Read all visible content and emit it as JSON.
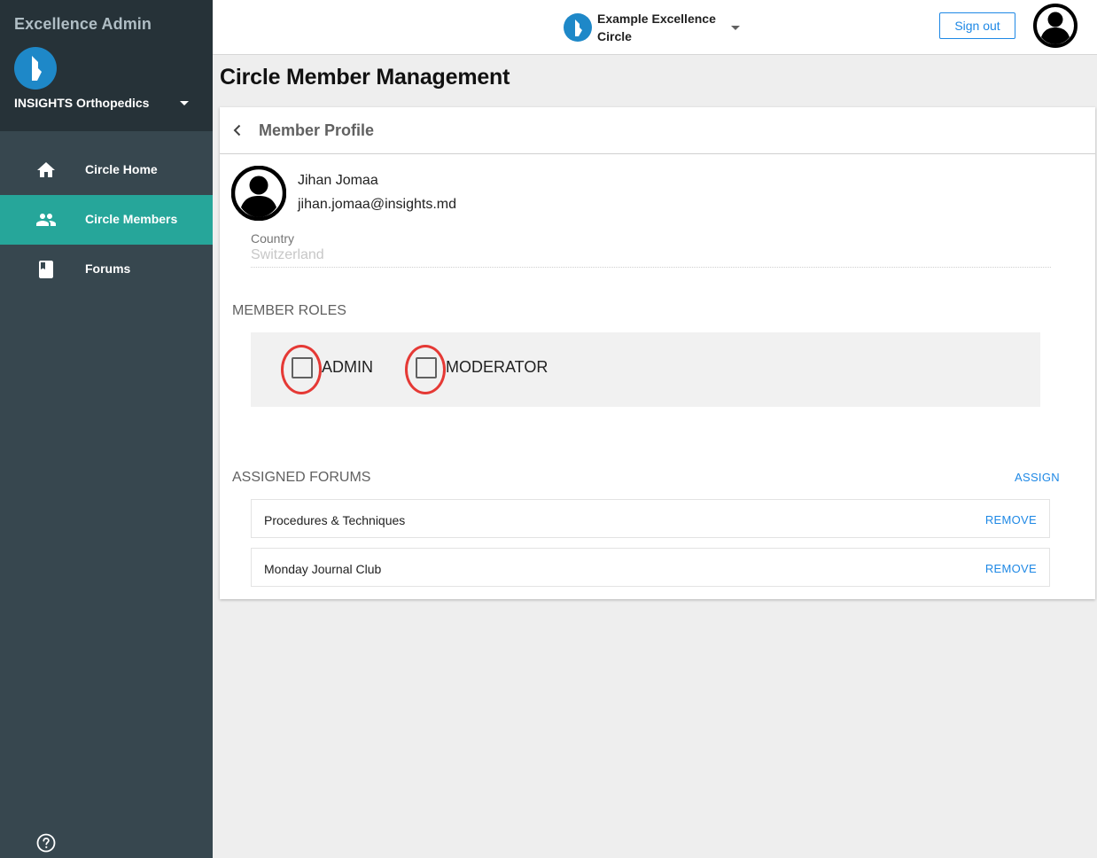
{
  "sidebar": {
    "app_title": "Excellence Admin",
    "org_name": "INSIGHTS Orthopedics",
    "items": [
      {
        "label": "Circle Home",
        "icon": "home-icon",
        "active": false
      },
      {
        "label": "Circle Members",
        "icon": "people-icon",
        "active": true
      },
      {
        "label": "Forums",
        "icon": "book-icon",
        "active": false
      }
    ]
  },
  "topbar": {
    "circle_name": "Example Excellence Circle",
    "signout_label": "Sign out"
  },
  "page": {
    "title": "Circle Member Management"
  },
  "profile": {
    "header_title": "Member Profile",
    "name": "Jihan Jomaa",
    "email": "jihan.jomaa@insights.md",
    "country_label": "Country",
    "country_value": "Switzerland"
  },
  "roles": {
    "heading": "MEMBER ROLES",
    "items": [
      {
        "label": "ADMIN",
        "checked": false
      },
      {
        "label": "MODERATOR",
        "checked": false
      }
    ]
  },
  "forums": {
    "heading": "ASSIGNED FORUMS",
    "assign_label": "ASSIGN",
    "items": [
      {
        "name": "Procedures & Techniques",
        "action": "REMOVE"
      },
      {
        "name": "Monday Journal Club",
        "action": "REMOVE"
      }
    ]
  },
  "colors": {
    "sidebar_bg": "#37474f",
    "sidebar_head_bg": "#263238",
    "active_item": "#26a69a",
    "link_blue": "#1e88e5",
    "highlight_red": "#e53935"
  }
}
